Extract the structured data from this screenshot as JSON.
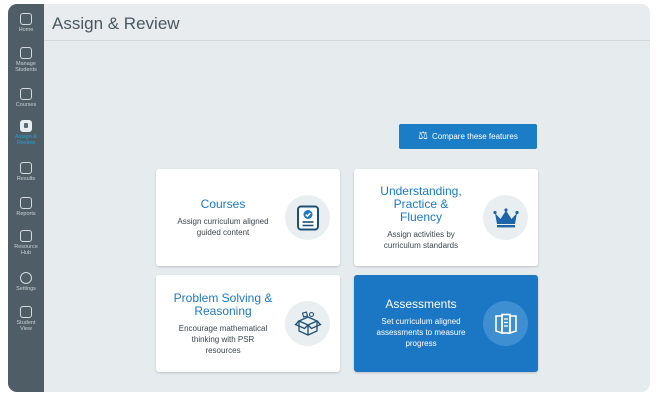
{
  "app": {
    "title": "Assign & Review"
  },
  "sidebar": {
    "items": [
      {
        "label": "Home",
        "icon": "home-icon"
      },
      {
        "label": "Manage Students",
        "icon": "students-icon"
      },
      {
        "label": "Courses",
        "icon": "courses-icon"
      },
      {
        "label": "Assign & Review",
        "icon": "assign-review-icon",
        "active": true
      },
      {
        "label": "Results",
        "icon": "results-icon"
      },
      {
        "label": "Reports",
        "icon": "reports-icon"
      },
      {
        "label": "Resource Hub",
        "icon": "resource-hub-icon"
      },
      {
        "label": "Settings",
        "icon": "settings-icon"
      },
      {
        "label": "Student View",
        "icon": "student-view-icon"
      }
    ]
  },
  "compare": {
    "label": "Compare these features",
    "icon": "scale-icon"
  },
  "cards": [
    {
      "title": "Courses",
      "description": "Assign curriculum aligned guided content",
      "icon": "course-badge-icon"
    },
    {
      "title": "Understanding, Practice & Fluency",
      "description": "Assign activities by curriculum standards",
      "icon": "crown-icon"
    },
    {
      "title": "Problem Solving & Reasoning",
      "description": "Encourage mathematical thinking with PSR resources",
      "icon": "box-icon"
    },
    {
      "title": "Assessments",
      "description": "Set curriculum aligned assessments to measure progress",
      "icon": "assessment-icon",
      "highlighted": true
    }
  ],
  "colors": {
    "accent": "#1b77c4",
    "sidebar": "#4f5e66",
    "background": "#e6ebee"
  }
}
